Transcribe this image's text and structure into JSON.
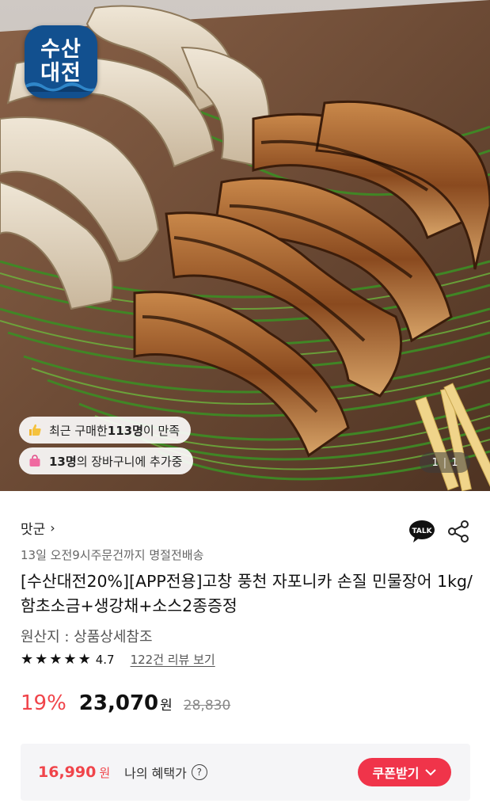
{
  "hero": {
    "logo": {
      "line1": "수산",
      "line2": "대전"
    },
    "pill_recent": {
      "prefix": "최근 구매한 ",
      "count": "113명",
      "suffix": "이 만족"
    },
    "pill_cart": {
      "count": "13명",
      "suffix": "의 장바구니에 추가중"
    },
    "counter": {
      "current": "1",
      "total": "1"
    },
    "icons": {
      "thumb": "thumbs-up-icon",
      "bag": "shopping-bag-icon"
    }
  },
  "product": {
    "brand": "맛군",
    "brand_chevron": "›",
    "delivery": "13일 오전9시주문건까지 명절전배송",
    "title": "[수산대전20%][APP전용]고창 풍천 자포니카 손질 민물장어 1kg/ 함초소금+생강채+소스2종증정",
    "origin": "원산지 : 상품상세참조",
    "rating": {
      "stars": 5,
      "value": "4.7",
      "review_link": "122건 리뷰 보기"
    },
    "price": {
      "discount": "19%",
      "sale": "23,070",
      "won": "원",
      "original": "28,830"
    },
    "benefit": {
      "price": "16,990",
      "won": "원",
      "label": "나의 혜택가",
      "help": "?",
      "coupon_button": "쿠폰받기"
    }
  },
  "colors": {
    "accent": "#f0444a",
    "logo_bg": "#12508f"
  }
}
